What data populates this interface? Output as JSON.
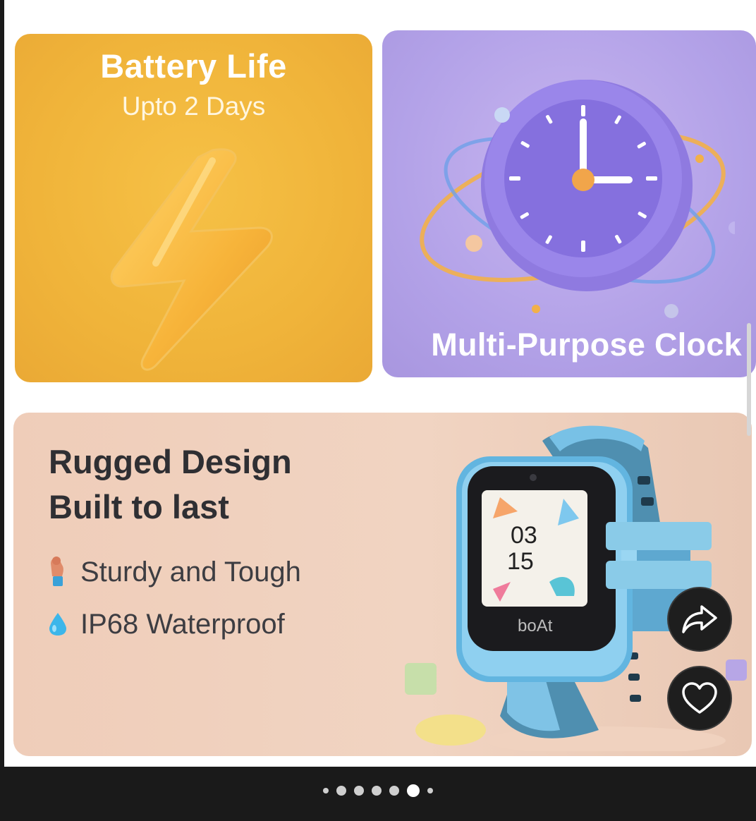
{
  "battery_card": {
    "title": "Battery Life",
    "subtitle": "Upto 2 Days",
    "icon": "lightning-bolt-icon"
  },
  "clock_card": {
    "title": "Multi-Purpose Clock",
    "icon": "clock-icon"
  },
  "rugged_card": {
    "heading_line1": "Rugged Design",
    "heading_line2": "Built to last",
    "features": [
      {
        "icon": "flexed-arm-icon",
        "label": "Sturdy and Tough"
      },
      {
        "icon": "water-drop-icon",
        "label": "IP68 Waterproof"
      }
    ],
    "watch": {
      "time_hour": "03",
      "time_minute": "15",
      "brand": "boAt"
    }
  },
  "actions": {
    "share_icon": "share-icon",
    "like_icon": "heart-icon"
  },
  "carousel": {
    "total": 7,
    "active_index": 5
  },
  "colors": {
    "battery_bg": "#f0b43a",
    "clock_bg": "#b3a2e8",
    "rugged_bg": "#efcdb9",
    "fab_bg": "#1e1e1e"
  }
}
